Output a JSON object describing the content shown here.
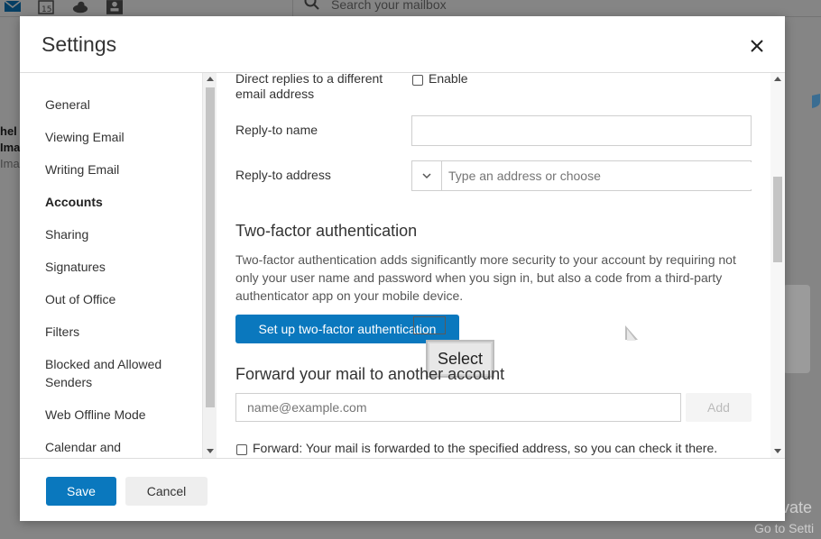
{
  "background": {
    "search_placeholder": "Search your mailbox",
    "left_strip": [
      "hel",
      "Ima",
      "Ima"
    ],
    "watermark_line1": "Activate",
    "watermark_line2": "Go to Setti"
  },
  "dialog": {
    "title": "Settings",
    "close_icon": "close-icon"
  },
  "sidebar": {
    "items": [
      {
        "label": "General"
      },
      {
        "label": "Viewing Email"
      },
      {
        "label": "Writing Email"
      },
      {
        "label": "Accounts",
        "active": true
      },
      {
        "label": "Sharing"
      },
      {
        "label": "Signatures"
      },
      {
        "label": "Out of Office"
      },
      {
        "label": "Filters"
      },
      {
        "label": "Blocked and Allowed Senders"
      },
      {
        "label": "Web Offline Mode"
      },
      {
        "label": "Calendar and"
      }
    ]
  },
  "content": {
    "direct_replies_label": "Direct replies to a different email address",
    "enable_label": "Enable",
    "reply_to_name_label": "Reply-to name",
    "reply_to_name_value": "",
    "reply_to_address_label": "Reply-to address",
    "reply_to_address_placeholder": "Type an address or choose",
    "two_factor_title": "Two-factor authentication",
    "two_factor_desc": "Two-factor authentication adds significantly more security to your account by requiring not only your user name and password when you sign in, but also a code from a third-party authenticator app on your mobile device.",
    "two_factor_button": "Set up two-factor authentication",
    "tooltip": "Select",
    "forward_title": "Forward your mail to another account",
    "forward_placeholder": "name@example.com",
    "add_button": "Add",
    "forward_checkbox_label": "Forward: Your mail is forwarded to the specified address, so you can check it there."
  },
  "footer": {
    "save_label": "Save",
    "cancel_label": "Cancel"
  },
  "colors": {
    "accent": "#0a78be"
  }
}
